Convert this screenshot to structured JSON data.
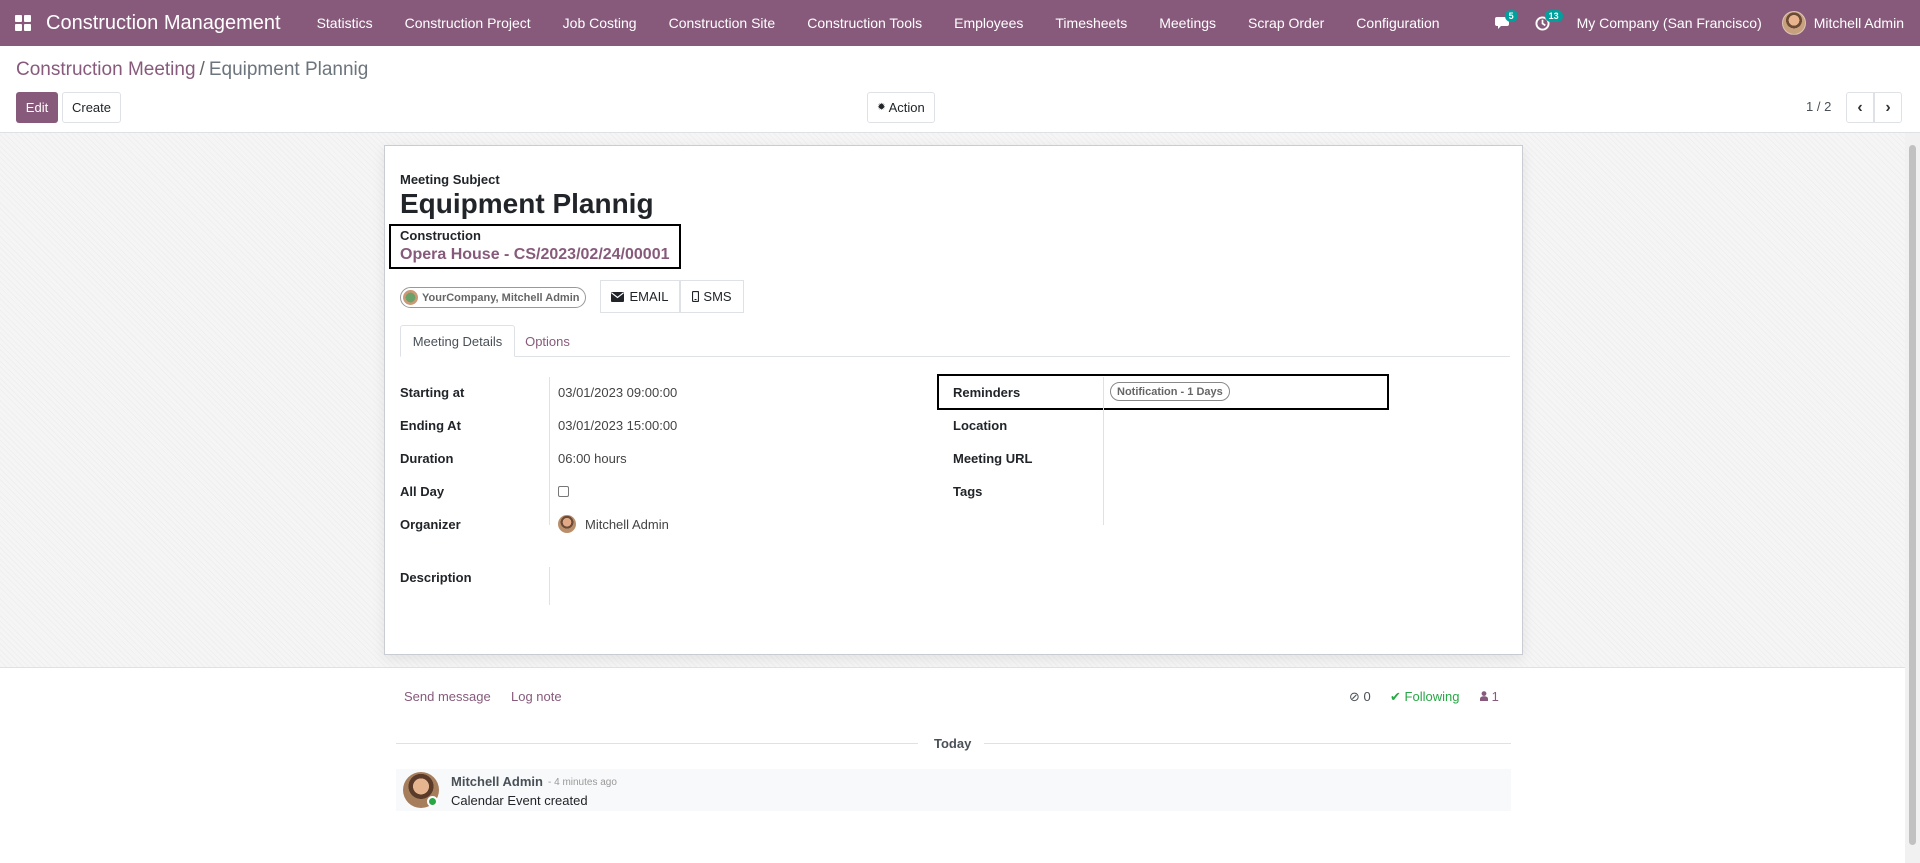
{
  "navbar": {
    "app_name": "Construction Management",
    "menu": [
      "Statistics",
      "Construction Project",
      "Job Costing",
      "Construction Site",
      "Construction Tools",
      "Employees",
      "Timesheets",
      "Meetings",
      "Scrap Order",
      "Configuration"
    ],
    "messages_count": "5",
    "activities_count": "13",
    "company": "My Company (San Francisco)",
    "user": "Mitchell Admin"
  },
  "breadcrumb": {
    "parent": "Construction Meeting",
    "separator": "/",
    "current": "Equipment Plannig"
  },
  "buttons": {
    "edit": "Edit",
    "create": "Create",
    "action": "Action"
  },
  "pager": {
    "value": "1 / 2"
  },
  "form": {
    "subject_label": "Meeting Subject",
    "subject": "Equipment Plannig",
    "construction_label": "Construction",
    "construction": "Opera House - CS/2023/02/24/00001",
    "attendee_tag": "YourCompany, Mitchell Admin",
    "email_button": "EMAIL",
    "sms_button": "SMS",
    "tabs": [
      "Meeting Details",
      "Options"
    ],
    "left_fields": [
      {
        "label": "Starting at",
        "value": "03/01/2023 09:00:00"
      },
      {
        "label": "Ending At",
        "value": "03/01/2023 15:00:00"
      },
      {
        "label": "Duration",
        "value": "06:00 hours"
      },
      {
        "label": "All Day",
        "value": ""
      },
      {
        "label": "Organizer",
        "value": "Mitchell Admin"
      }
    ],
    "all_day_checked": false,
    "description_label": "Description",
    "right_fields": [
      {
        "label": "Reminders",
        "value": "Notification - 1 Days"
      },
      {
        "label": "Location",
        "value": ""
      },
      {
        "label": "Meeting URL",
        "value": ""
      },
      {
        "label": "Tags",
        "value": ""
      }
    ]
  },
  "chatter": {
    "send_message": "Send message",
    "log_note": "Log note",
    "attachments": "0",
    "following": "Following",
    "followers": "1",
    "date_separator": "Today",
    "messages": [
      {
        "author": "Mitchell Admin",
        "time": "- 4 minutes ago",
        "body": "Calendar Event created"
      }
    ]
  },
  "colors": {
    "brand": "#875a7b",
    "badge": "#00a09d",
    "following": "#28a745"
  }
}
